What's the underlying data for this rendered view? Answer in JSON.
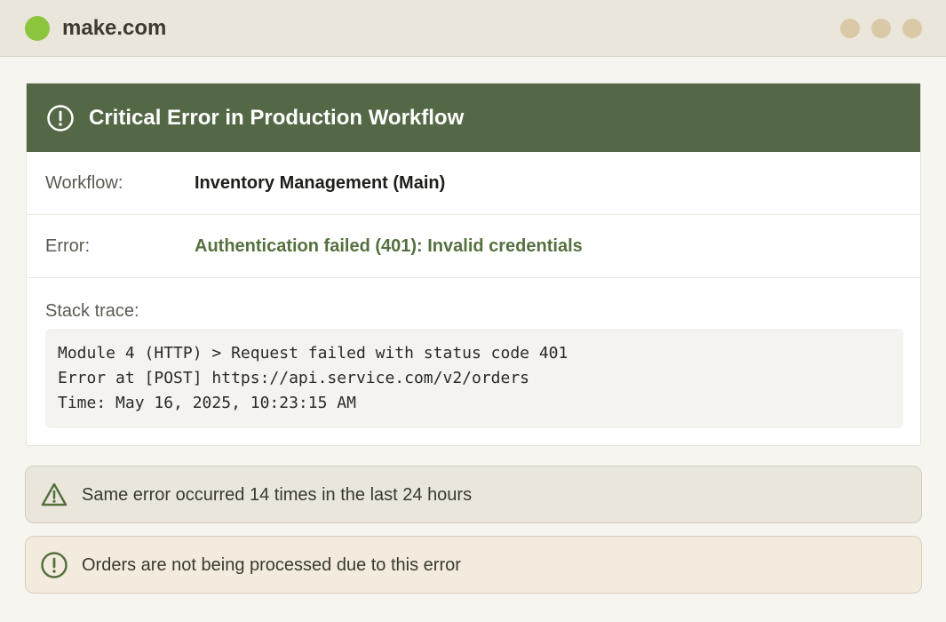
{
  "app": {
    "title": "make.com",
    "brand_color": "#8cc63f",
    "window_controls": [
      "minimize",
      "maximize",
      "close"
    ]
  },
  "error_card": {
    "header": {
      "title": "Critical Error in Production Workflow",
      "icon": "alert-circle-icon",
      "color": "#546846"
    },
    "fields": [
      {
        "label": "Workflow:",
        "value": "Inventory Management (Main)"
      },
      {
        "label": "Error:",
        "value": "Authentication failed (401): Invalid credentials"
      }
    ],
    "stack": {
      "label": "Stack trace:",
      "lines": [
        "Module 4 (HTTP) > Request failed with status code 401",
        "Error at [POST] https://api.service.com/v2/orders",
        "Time: May 16, 2025, 10:23:15 AM"
      ]
    }
  },
  "alerts": [
    {
      "icon": "warning-triangle-icon",
      "text": "Same error occurred 14 times in the last 24 hours"
    },
    {
      "icon": "alert-circle-icon",
      "text": "Orders are not being processed due to this error"
    }
  ]
}
